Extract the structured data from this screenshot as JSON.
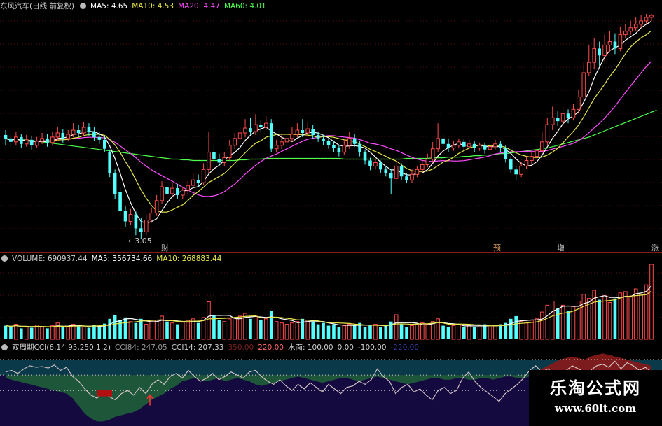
{
  "price_panel": {
    "title": "东风汽车(日线 前复权)",
    "ma5": "MA5: 4.65",
    "ma10": "MA10: 4.53",
    "ma20": "MA20: 4.47",
    "ma60": "MA60: 4.01",
    "low_label": "←3.05",
    "events": [
      "财",
      "预",
      "增",
      "涨"
    ]
  },
  "volume_panel": {
    "volume": "VOLUME: 690937.44",
    "ma5": "MA5: 356734.66",
    "ma10": "MA10: 268883.44"
  },
  "cci_panel": {
    "title": "双周期CCI(6,14,95,250,1,2)",
    "cci84": "CCI84: 247.05",
    "cci14": "CCI14: 207.33",
    "l350": "350.00",
    "l220": "220.00",
    "water": "水面: 100.00",
    "zero": "0.00",
    "neg100": "-100.00",
    "neg220": "-220.00"
  },
  "watermark": {
    "line1": "乐淘公式网",
    "line2": "www.60lt.com"
  },
  "colors": {
    "up": "#ff4c4c",
    "down": "#54ffff",
    "ma5": "#ffffff",
    "ma10": "#e8e84a",
    "ma20": "#ff4cff",
    "ma60": "#4cff4c"
  },
  "chart_data": {
    "type": "candlestick",
    "title": "东风汽车(日线 前复权)",
    "ylim": [
      2.9,
      6.3
    ],
    "min_low": 3.05,
    "candles": [
      [
        4.55,
        4.5,
        4.62,
        4.4
      ],
      [
        4.5,
        4.45,
        4.58,
        4.38
      ],
      [
        4.45,
        4.52,
        4.6,
        4.4
      ],
      [
        4.52,
        4.42,
        4.56,
        4.36
      ],
      [
        4.42,
        4.48,
        4.55,
        4.38
      ],
      [
        4.48,
        4.4,
        4.54,
        4.34
      ],
      [
        4.4,
        4.46,
        4.52,
        4.36
      ],
      [
        4.46,
        4.5,
        4.58,
        4.42
      ],
      [
        4.5,
        4.44,
        4.56,
        4.38
      ],
      [
        4.44,
        4.52,
        4.6,
        4.4
      ],
      [
        4.52,
        4.58,
        4.66,
        4.46
      ],
      [
        4.58,
        4.5,
        4.64,
        4.44
      ],
      [
        4.5,
        4.56,
        4.62,
        4.46
      ],
      [
        4.56,
        4.62,
        4.72,
        4.52
      ],
      [
        4.62,
        4.58,
        4.7,
        4.52
      ],
      [
        4.58,
        4.66,
        4.74,
        4.54
      ],
      [
        4.66,
        4.6,
        4.72,
        4.54
      ],
      [
        4.6,
        4.52,
        4.66,
        4.46
      ],
      [
        4.52,
        4.48,
        4.6,
        4.42
      ],
      [
        4.48,
        4.35,
        4.52,
        4.3
      ],
      [
        4.3,
        4.0,
        4.34,
        3.94
      ],
      [
        4.0,
        3.7,
        4.05,
        3.62
      ],
      [
        3.72,
        3.45,
        3.78,
        3.38
      ],
      [
        3.45,
        3.3,
        3.52,
        3.22
      ],
      [
        3.3,
        3.4,
        3.48,
        3.25
      ],
      [
        3.4,
        3.2,
        3.45,
        3.1
      ],
      [
        3.2,
        3.15,
        3.35,
        3.05
      ],
      [
        3.15,
        3.32,
        3.4,
        3.1
      ],
      [
        3.32,
        3.42,
        3.5,
        3.28
      ],
      [
        3.42,
        3.6,
        3.68,
        3.38
      ],
      [
        3.6,
        3.8,
        3.88,
        3.55
      ],
      [
        3.8,
        3.7,
        3.92,
        3.64
      ],
      [
        3.7,
        3.78,
        3.85,
        3.65
      ],
      [
        3.78,
        3.68,
        3.84,
        3.62
      ],
      [
        3.68,
        3.75,
        3.8,
        3.62
      ],
      [
        3.75,
        3.82,
        3.88,
        3.7
      ],
      [
        3.82,
        3.9,
        4.0,
        3.78
      ],
      [
        3.9,
        3.86,
        3.98,
        3.8
      ],
      [
        3.86,
        4.05,
        4.14,
        3.82
      ],
      [
        4.05,
        4.3,
        4.6,
        4.0
      ],
      [
        4.3,
        4.2,
        4.4,
        4.15
      ],
      [
        4.2,
        4.15,
        4.28,
        4.1
      ],
      [
        4.15,
        4.22,
        4.3,
        4.1
      ],
      [
        4.22,
        4.4,
        4.48,
        4.18
      ],
      [
        4.4,
        4.5,
        4.58,
        4.35
      ],
      [
        4.5,
        4.58,
        4.66,
        4.45
      ],
      [
        4.58,
        4.65,
        4.78,
        4.52
      ],
      [
        4.65,
        4.6,
        4.8,
        4.55
      ],
      [
        4.6,
        4.7,
        4.85,
        4.55
      ],
      [
        4.7,
        4.66,
        4.76,
        4.6
      ],
      [
        4.66,
        4.72,
        4.82,
        4.62
      ],
      [
        4.72,
        4.35,
        4.78,
        4.3
      ],
      [
        4.35,
        4.4,
        4.48,
        4.3
      ],
      [
        4.4,
        4.45,
        4.55,
        4.35
      ],
      [
        4.45,
        4.5,
        4.58,
        4.4
      ],
      [
        4.5,
        4.56,
        4.66,
        4.45
      ],
      [
        4.56,
        4.62,
        4.72,
        4.52
      ],
      [
        4.62,
        4.58,
        4.78,
        4.52
      ],
      [
        4.58,
        4.64,
        4.74,
        4.54
      ],
      [
        4.64,
        4.55,
        4.7,
        4.5
      ],
      [
        4.55,
        4.5,
        4.6,
        4.45
      ],
      [
        4.5,
        4.46,
        4.55,
        4.4
      ],
      [
        4.46,
        4.4,
        4.5,
        4.35
      ],
      [
        4.4,
        4.36,
        4.46,
        4.3
      ],
      [
        4.36,
        4.3,
        4.4,
        4.24
      ],
      [
        4.3,
        4.4,
        4.48,
        4.26
      ],
      [
        4.4,
        4.5,
        4.6,
        4.35
      ],
      [
        4.5,
        4.42,
        4.56,
        4.38
      ],
      [
        4.42,
        4.3,
        4.46,
        4.24
      ],
      [
        4.3,
        4.18,
        4.34,
        4.12
      ],
      [
        4.18,
        4.1,
        4.22,
        4.04
      ],
      [
        4.1,
        4.15,
        4.2,
        4.05
      ],
      [
        4.15,
        4.05,
        4.18,
        4.0
      ],
      [
        4.05,
        4.0,
        4.1,
        3.95
      ],
      [
        4.0,
        3.92,
        4.05,
        3.7
      ],
      [
        3.92,
        4.1,
        4.18,
        3.88
      ],
      [
        4.1,
        3.95,
        4.14,
        3.9
      ],
      [
        3.95,
        3.9,
        4.0,
        3.85
      ],
      [
        3.9,
        3.98,
        4.05,
        3.86
      ],
      [
        3.98,
        4.05,
        4.1,
        3.94
      ],
      [
        4.05,
        4.12,
        4.18,
        4.0
      ],
      [
        4.12,
        4.2,
        4.28,
        4.08
      ],
      [
        4.2,
        4.35,
        4.45,
        4.15
      ],
      [
        4.35,
        4.5,
        4.72,
        4.3
      ],
      [
        4.5,
        4.42,
        4.56,
        4.38
      ],
      [
        4.42,
        4.36,
        4.5,
        4.3
      ],
      [
        4.36,
        4.4,
        4.46,
        4.32
      ],
      [
        4.4,
        4.45,
        4.5,
        4.36
      ],
      [
        4.45,
        4.38,
        4.5,
        4.32
      ],
      [
        4.38,
        4.42,
        4.48,
        4.35
      ],
      [
        4.42,
        4.36,
        4.46,
        4.3
      ],
      [
        4.36,
        4.4,
        4.44,
        4.32
      ],
      [
        4.4,
        4.34,
        4.44,
        4.28
      ],
      [
        4.34,
        4.38,
        4.42,
        4.3
      ],
      [
        4.38,
        4.42,
        4.48,
        4.34
      ],
      [
        4.42,
        4.36,
        4.46,
        4.3
      ],
      [
        4.36,
        4.2,
        4.4,
        4.15
      ],
      [
        4.2,
        4.05,
        4.24,
        4.0
      ],
      [
        4.05,
        3.98,
        4.1,
        3.9
      ],
      [
        3.98,
        4.1,
        4.16,
        3.94
      ],
      [
        4.1,
        4.18,
        4.24,
        4.06
      ],
      [
        4.18,
        4.24,
        4.3,
        4.12
      ],
      [
        4.24,
        4.32,
        4.4,
        4.2
      ],
      [
        4.32,
        4.45,
        4.6,
        4.28
      ],
      [
        4.45,
        4.7,
        4.8,
        4.4
      ],
      [
        4.7,
        4.8,
        4.96,
        4.62
      ],
      [
        4.8,
        4.75,
        4.9,
        4.68
      ],
      [
        4.75,
        4.86,
        4.96,
        4.7
      ],
      [
        4.86,
        4.8,
        4.92,
        4.72
      ],
      [
        4.8,
        4.92,
        5.0,
        4.76
      ],
      [
        4.92,
        5.1,
        5.2,
        4.86
      ],
      [
        5.1,
        5.45,
        5.6,
        5.05
      ],
      [
        5.45,
        5.6,
        5.85,
        5.4
      ],
      [
        5.6,
        5.8,
        5.95,
        5.5
      ],
      [
        5.8,
        5.7,
        5.9,
        5.55
      ],
      [
        5.7,
        5.85,
        6.0,
        5.62
      ],
      [
        5.85,
        5.9,
        6.05,
        5.75
      ],
      [
        5.9,
        5.8,
        6.02,
        5.72
      ],
      [
        5.8,
        6.0,
        6.12,
        5.76
      ],
      [
        6.0,
        6.05,
        6.15,
        5.95
      ],
      [
        6.05,
        6.1,
        6.2,
        6.0
      ],
      [
        6.1,
        6.15,
        6.25,
        6.05
      ],
      [
        6.15,
        6.2,
        6.28,
        6.1
      ],
      [
        6.2,
        6.25,
        6.3,
        6.15
      ],
      [
        6.25,
        6.28,
        6.3,
        6.2
      ]
    ],
    "ma60": [
      4.5,
      4.49,
      4.49,
      4.48,
      4.48,
      4.47,
      4.46,
      4.45,
      4.44,
      4.43,
      4.42,
      4.41,
      4.4,
      4.39,
      4.38,
      4.37,
      4.36,
      4.35,
      4.34,
      4.33,
      4.32,
      4.31,
      4.3,
      4.29,
      4.28,
      4.27,
      4.26,
      4.25,
      4.24,
      4.23,
      4.22,
      4.21,
      4.2,
      4.2,
      4.19,
      4.19,
      4.18,
      4.18,
      4.18,
      4.18,
      4.18,
      4.18,
      4.18,
      4.18,
      4.18,
      4.19,
      4.19,
      4.2,
      4.2,
      4.2,
      4.21,
      4.21,
      4.21,
      4.21,
      4.21,
      4.21,
      4.21,
      4.21,
      4.21,
      4.21,
      4.21,
      4.21,
      4.21,
      4.21,
      4.21,
      4.2,
      4.2,
      4.2,
      4.2,
      4.2,
      4.2,
      4.2,
      4.2,
      4.2,
      4.2,
      4.2,
      4.2,
      4.21,
      4.21,
      4.21,
      4.21,
      4.21,
      4.22,
      4.22,
      4.22,
      4.23,
      4.23,
      4.23,
      4.24,
      4.24,
      4.25,
      4.25,
      4.26,
      4.26,
      4.27,
      4.28,
      4.28,
      4.29,
      4.3,
      4.31,
      4.32,
      4.33,
      4.34,
      4.35,
      4.36,
      4.38,
      4.4,
      4.42,
      4.44,
      4.46,
      4.48,
      4.5,
      4.52,
      4.55,
      4.58,
      4.61,
      4.64,
      4.67,
      4.7,
      4.73,
      4.76,
      4.79,
      4.82,
      4.85,
      4.88,
      4.91
    ]
  },
  "volume_data": [
    20,
    18,
    22,
    16,
    19,
    17,
    21,
    18,
    16,
    20,
    24,
    18,
    19,
    22,
    20,
    18,
    17,
    21,
    19,
    23,
    30,
    36,
    28,
    32,
    26,
    24,
    30,
    22,
    26,
    28,
    34,
    26,
    24,
    22,
    25,
    28,
    30,
    24,
    32,
    55,
    36,
    28,
    26,
    30,
    32,
    34,
    38,
    30,
    34,
    28,
    30,
    42,
    26,
    24,
    22,
    24,
    26,
    30,
    28,
    26,
    22,
    24,
    20,
    22,
    18,
    20,
    22,
    20,
    24,
    18,
    20,
    22,
    18,
    20,
    26,
    36,
    22,
    18,
    20,
    22,
    24,
    22,
    26,
    30,
    20,
    18,
    20,
    22,
    18,
    20,
    18,
    20,
    22,
    18,
    20,
    22,
    24,
    30,
    34,
    26,
    24,
    28,
    30,
    40,
    50,
    56,
    46,
    50,
    42,
    48,
    56,
    66,
    60,
    72,
    58,
    64,
    54,
    60,
    68,
    70,
    62,
    74,
    66,
    80,
    110
  ],
  "cci_data": [
    20,
    30,
    10,
    40,
    60,
    50,
    55,
    45,
    65,
    30,
    50,
    -10,
    -40,
    -90,
    -130,
    -150,
    -110,
    -140,
    -160,
    -120,
    -100,
    -130,
    -80,
    -120,
    -60,
    -30,
    -60,
    -10,
    10,
    -20,
    30,
    -10,
    -40,
    -20,
    10,
    -30,
    -10,
    20,
    0,
    -20,
    20,
    30,
    -10,
    -40,
    -60,
    -30,
    -70,
    -100,
    -60,
    -90,
    -50,
    -80,
    -110,
    -60,
    -90,
    -120,
    -80,
    -70,
    -40,
    -60,
    -30,
    40,
    -10,
    -40,
    -120,
    -80,
    -60,
    -110,
    -90,
    -130,
    -160,
    -100,
    -80,
    -120,
    -100,
    -20,
    20,
    -40,
    -80,
    -110,
    -140,
    -170,
    -120,
    -90,
    -60,
    -20,
    30,
    60,
    20,
    40,
    10,
    -10,
    30,
    60,
    40,
    20,
    30,
    60,
    70,
    50,
    90,
    40,
    80,
    60,
    30,
    50,
    20
  ],
  "cci_area": [
    -20,
    -30,
    -40,
    -50,
    -60,
    -70,
    -80,
    -90,
    -100,
    -110,
    -120,
    -150,
    -200,
    -250,
    -280,
    -300,
    -300,
    -290,
    -270,
    -260,
    -250,
    -240,
    -220,
    -190,
    -160,
    -140,
    -120,
    -90,
    -70,
    -40,
    -30,
    -20,
    -30,
    -40,
    -30,
    -20,
    -40,
    -30,
    -20,
    -30,
    -40,
    -60,
    -70,
    -60,
    -50,
    -40,
    -30,
    -20,
    -10,
    -20,
    -30,
    -40,
    -50,
    -40,
    -30,
    -20,
    -20,
    -30,
    -40,
    -30,
    -20,
    -10,
    -20,
    -30,
    -40,
    -50,
    -60,
    -50,
    -40,
    -30,
    -20,
    -20,
    -30,
    -30,
    -20,
    -20,
    -30,
    -30,
    -20,
    -20,
    -30,
    -20,
    -10,
    -10,
    -20,
    -20,
    -10,
    20,
    40,
    60,
    80,
    100,
    110,
    120,
    110,
    100,
    120,
    130,
    140,
    130,
    120,
    110,
    100,
    90,
    80,
    70,
    60
  ]
}
